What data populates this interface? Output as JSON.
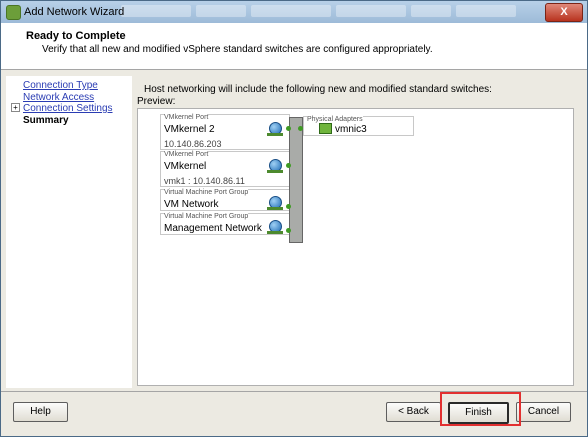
{
  "window": {
    "title": "Add Network Wizard",
    "close_glyph": "X"
  },
  "header": {
    "title": "Ready to Complete",
    "subtitle": "Verify that all new and modified vSphere standard switches are configured appropriately."
  },
  "nav": {
    "items": [
      {
        "label": "Connection Type"
      },
      {
        "label": "Network Access"
      },
      {
        "label": "Connection Settings"
      },
      {
        "label": "Summary"
      }
    ],
    "expander_glyph": "+"
  },
  "main": {
    "intro": "Host networking will include the following new and modified standard switches:",
    "preview_label": "Preview:",
    "port_groups": [
      {
        "type": "VMkernel Port",
        "name": "VMkernel 2",
        "ip": "10.140.86.203"
      },
      {
        "type": "VMkernel Port",
        "name": "VMkernel",
        "ip": "vmk1 : 10.140.86.11"
      },
      {
        "type": "Virtual Machine Port Group",
        "name": "VM Network"
      },
      {
        "type": "Virtual Machine Port Group",
        "name": "Management Network"
      }
    ],
    "physical_adapters": {
      "label": "Physical Adapters",
      "name": "vmnic3"
    }
  },
  "footer": {
    "help": "Help",
    "back": "< Back",
    "finish": "Finish",
    "cancel": "Cancel"
  }
}
